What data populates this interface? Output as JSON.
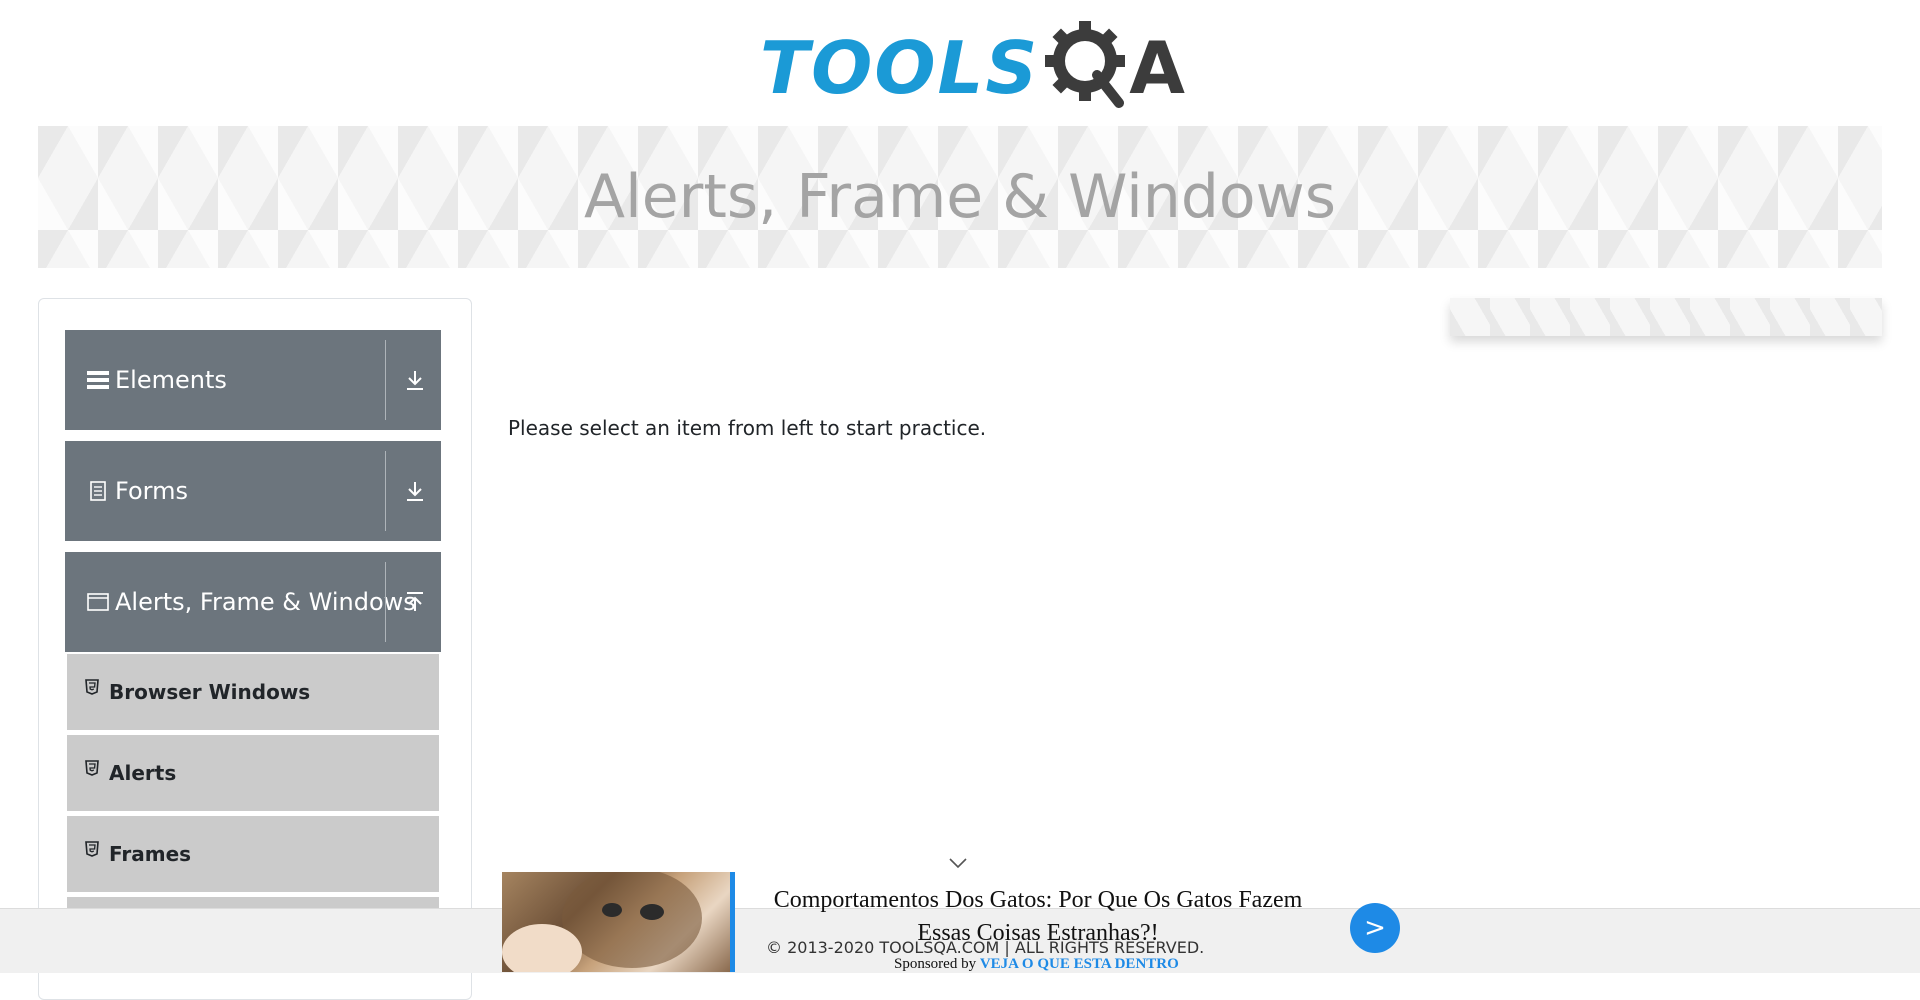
{
  "header": {
    "logo_text": "TOOLS",
    "logo_suffix": "A",
    "logo_icon": "gear-magnifier-icon",
    "logo_color": "#1b9ad6"
  },
  "banner": {
    "title": "Alerts, Frame & Windows"
  },
  "sidebar": {
    "groups": [
      {
        "label": "Elements",
        "icon": "hamburger-icon",
        "toggle": "expand-down-icon",
        "expanded": false
      },
      {
        "label": "Forms",
        "icon": "document-icon",
        "toggle": "expand-down-icon",
        "expanded": false
      },
      {
        "label": "Alerts, Frame & Windows",
        "icon": "window-icon",
        "toggle": "collapse-up-icon",
        "expanded": true
      }
    ],
    "items": [
      {
        "label": "Browser Windows",
        "icon": "html5-icon"
      },
      {
        "label": "Alerts",
        "icon": "html5-icon"
      },
      {
        "label": "Frames",
        "icon": "html5-icon"
      }
    ]
  },
  "main": {
    "instruction": "Please select an item from left to start practice."
  },
  "footer": {
    "copyright": "© 2013-2020 TOOLSQA.COM | ALL RIGHTS RESERVED."
  },
  "ad": {
    "title": "Comportamentos Dos Gatos: Por Que Os Gatos Fazem Essas Coisas Estranhas?!",
    "sponsored_prefix": "Sponsored by",
    "sponsor": "VEJA O QUE ESTA DENTRO",
    "go_label": ">",
    "accent": "#1e8ae6"
  },
  "colors": {
    "group_header_bg": "#6c757d",
    "menu_item_bg": "#cbcbcb",
    "banner_text": "#a4a4a4"
  }
}
